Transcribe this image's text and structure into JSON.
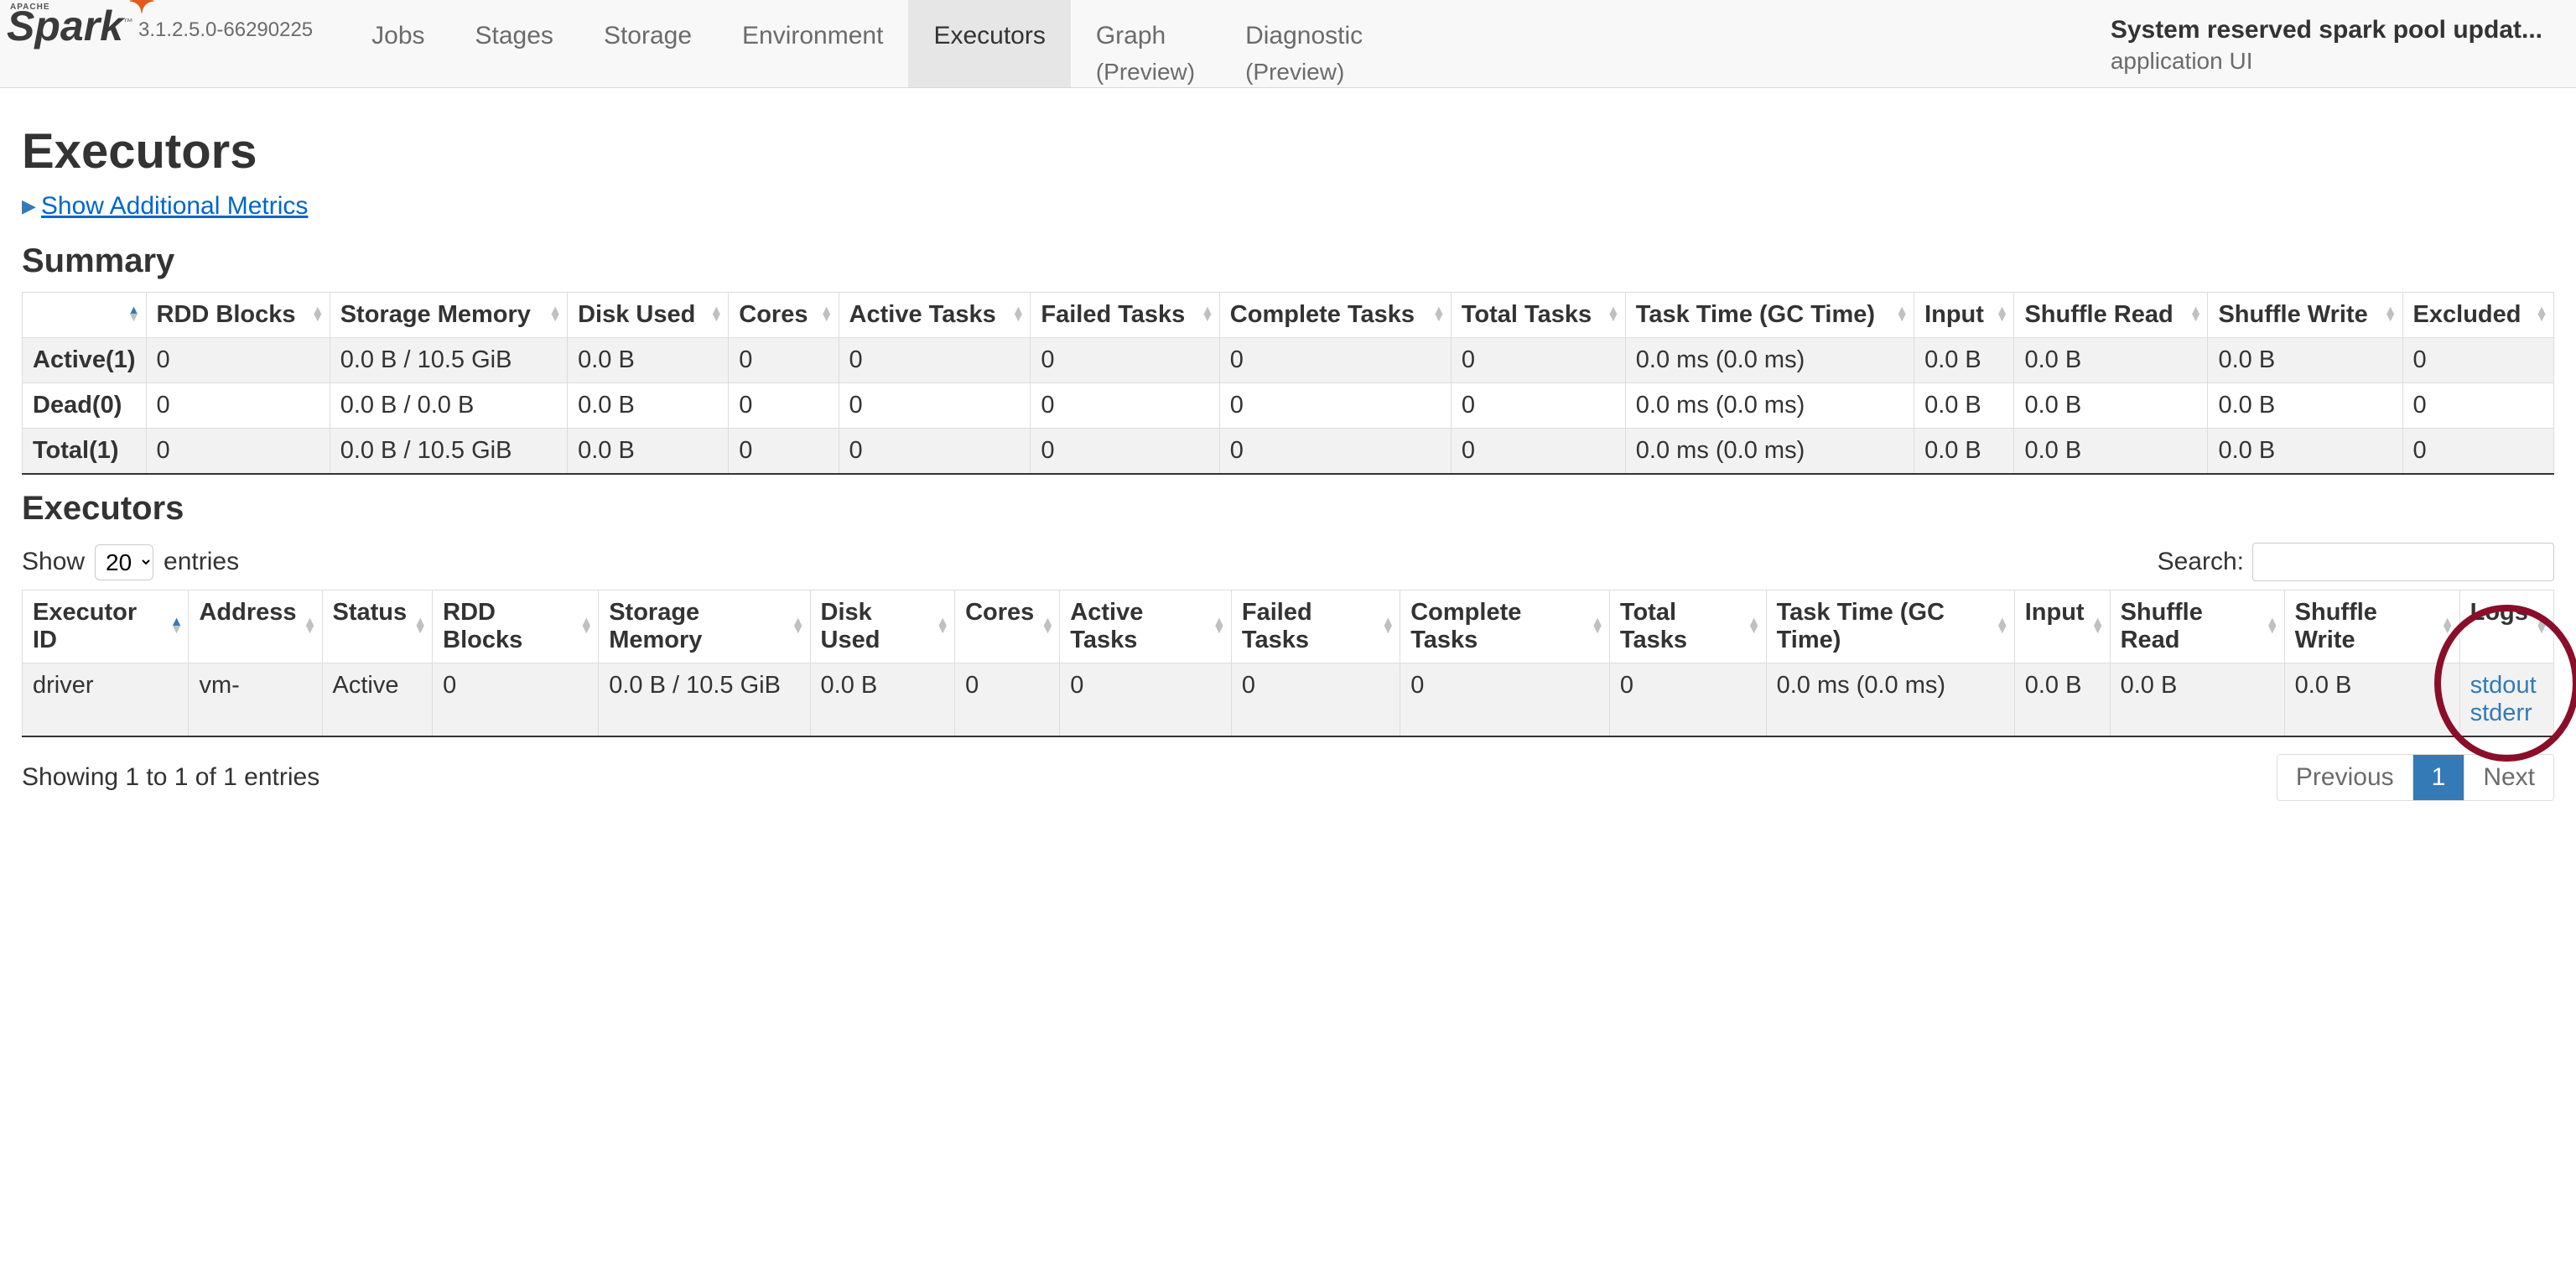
{
  "nav": {
    "logo_main": "Spark",
    "logo_apache": "APACHE",
    "logo_tm": "™",
    "version": "3.1.2.5.0-66290225",
    "tabs": [
      {
        "label": "Jobs",
        "sub": ""
      },
      {
        "label": "Stages",
        "sub": ""
      },
      {
        "label": "Storage",
        "sub": ""
      },
      {
        "label": "Environment",
        "sub": ""
      },
      {
        "label": "Executors",
        "sub": "",
        "active": true
      },
      {
        "label": "Graph",
        "sub": "(Preview)"
      },
      {
        "label": "Diagnostic",
        "sub": "(Preview)"
      }
    ],
    "app_title": "System reserved spark pool updat...",
    "app_sub": "application UI"
  },
  "page": {
    "title": "Executors",
    "toggle_label": "Show Additional Metrics",
    "summary_heading": "Summary",
    "executors_heading": "Executors"
  },
  "summary_table": {
    "headers": [
      "",
      "RDD Blocks",
      "Storage Memory",
      "Disk Used",
      "Cores",
      "Active Tasks",
      "Failed Tasks",
      "Complete Tasks",
      "Total Tasks",
      "Task Time (GC Time)",
      "Input",
      "Shuffle Read",
      "Shuffle Write",
      "Excluded"
    ],
    "rows": [
      [
        "Active(1)",
        "0",
        "0.0 B / 10.5 GiB",
        "0.0 B",
        "0",
        "0",
        "0",
        "0",
        "0",
        "0.0 ms (0.0 ms)",
        "0.0 B",
        "0.0 B",
        "0.0 B",
        "0"
      ],
      [
        "Dead(0)",
        "0",
        "0.0 B / 0.0 B",
        "0.0 B",
        "0",
        "0",
        "0",
        "0",
        "0",
        "0.0 ms (0.0 ms)",
        "0.0 B",
        "0.0 B",
        "0.0 B",
        "0"
      ],
      [
        "Total(1)",
        "0",
        "0.0 B / 10.5 GiB",
        "0.0 B",
        "0",
        "0",
        "0",
        "0",
        "0",
        "0.0 ms (0.0 ms)",
        "0.0 B",
        "0.0 B",
        "0.0 B",
        "0"
      ]
    ]
  },
  "executors_table": {
    "show_label_pre": "Show",
    "show_label_post": "entries",
    "page_size": "20",
    "search_label": "Search:",
    "headers": [
      "Executor ID",
      "Address",
      "Status",
      "RDD Blocks",
      "Storage Memory",
      "Disk Used",
      "Cores",
      "Active Tasks",
      "Failed Tasks",
      "Complete Tasks",
      "Total Tasks",
      "Task Time (GC Time)",
      "Input",
      "Shuffle Read",
      "Shuffle Write",
      "Logs"
    ],
    "rows": [
      {
        "cells": [
          "driver",
          "vm-",
          "Active",
          "0",
          "0.0 B / 10.5 GiB",
          "0.0 B",
          "0",
          "0",
          "0",
          "0",
          "0",
          "0.0 ms (0.0 ms)",
          "0.0 B",
          "0.0 B",
          "0.0 B"
        ],
        "logs": [
          "stdout",
          "stderr"
        ]
      }
    ],
    "info_text": "Showing 1 to 1 of 1 entries",
    "pager": {
      "prev": "Previous",
      "pages": [
        "1"
      ],
      "next": "Next",
      "active": "1"
    }
  }
}
